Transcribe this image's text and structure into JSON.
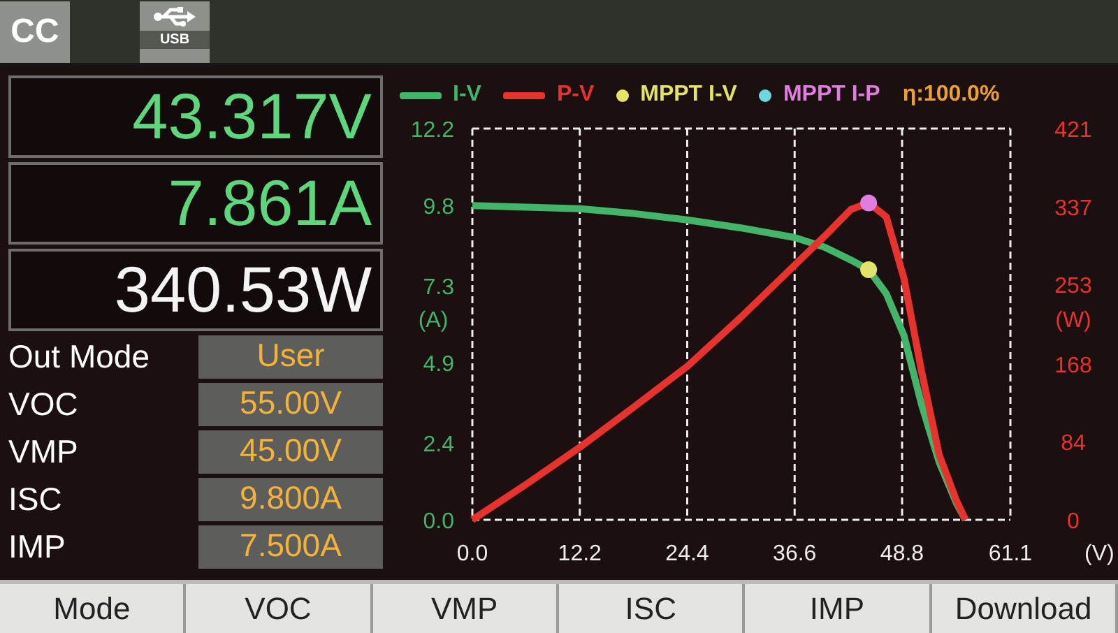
{
  "status_bar": {
    "mode_badge": "CC",
    "usb_label": "USB"
  },
  "readouts": [
    {
      "value": "43.317V",
      "color": "#5ed67c"
    },
    {
      "value": "7.861A",
      "color": "#5ed67c"
    },
    {
      "value": "340.53W",
      "color": "#f4f4f4"
    }
  ],
  "parameters": [
    {
      "label": "Out Mode",
      "value": "User"
    },
    {
      "label": "VOC",
      "value": "55.00V"
    },
    {
      "label": "VMP",
      "value": "45.00V"
    },
    {
      "label": "ISC",
      "value": "9.800A"
    },
    {
      "label": "IMP",
      "value": "7.500A"
    }
  ],
  "chart": {
    "legend": [
      {
        "color": "#43b56a"
      },
      {
        "color": "#e8322e"
      },
      {
        "color": "#e3e36a"
      },
      {
        "color": "#6fd6df"
      }
    ],
    "efficiency": "η:100.0%",
    "current_chart": {
      "chart_data": {
        "type": "line",
        "xlabel": "(V)",
        "ylabel": "(A)",
        "grid": true,
        "x": [
          0,
          6.1,
          12.2,
          18.3,
          24.4,
          30.5,
          36.6,
          40,
          43,
          45,
          47,
          49,
          51,
          53,
          55,
          56
        ],
        "series": [
          {
            "name": "I-V",
            "color": "#43b56a",
            "values": [
              9.8,
              9.75,
              9.7,
              9.55,
              9.35,
              9.1,
              8.8,
              8.5,
              8.1,
              7.8,
              7.05,
              5.75,
              3.6,
              1.8,
              0.5,
              0
            ]
          },
          {
            "name": "MPPT I-V",
            "color": "#e3e36a",
            "marker": true,
            "values": [
              null,
              null,
              null,
              null,
              null,
              null,
              null,
              null,
              null,
              7.8,
              null,
              null,
              null,
              null,
              null,
              null
            ]
          }
        ],
        "xlim": [
          0,
          61.1
        ],
        "ylim": [
          0,
          12.2
        ],
        "xticks": [
          {
            "value": 0,
            "label": "0.0"
          },
          {
            "value": 12.2,
            "label": "12.2"
          },
          {
            "value": 24.4,
            "label": "24.4"
          },
          {
            "value": 36.6,
            "label": "36.6"
          },
          {
            "value": 48.8,
            "label": "48.8"
          },
          {
            "value": 61.1,
            "label": "61.1"
          }
        ],
        "yticks": [
          {
            "value": 0,
            "label": "0.0"
          },
          {
            "value": 2.4,
            "label": "2.4"
          },
          {
            "value": 4.9,
            "label": "4.9"
          },
          {
            "value": 7.3,
            "label": "7.3"
          },
          {
            "value": 9.8,
            "label": "9.8"
          },
          {
            "value": 12.2,
            "label": "12.2"
          }
        ]
      }
    },
    "power_chart": {
      "chart_data": {
        "type": "line",
        "ylabel": "(W)",
        "x": [
          0,
          6.1,
          12.2,
          18.3,
          24.4,
          30.5,
          36.6,
          40,
          43,
          45,
          47,
          49,
          51,
          53,
          55,
          56
        ],
        "series": [
          {
            "name": "P-V",
            "color": "#e8322e",
            "values": [
              0,
              38,
              78,
              121,
              165,
              218,
              274,
              305,
              334,
              341,
              326,
              260,
              160,
              70,
              20,
              0
            ]
          },
          {
            "name": "MPPT I-P",
            "color": "#e07de0",
            "marker": true,
            "values": [
              null,
              null,
              null,
              null,
              null,
              null,
              null,
              null,
              null,
              341,
              null,
              null,
              null,
              null,
              null,
              null
            ]
          }
        ],
        "xlim": [
          0,
          61.1
        ],
        "ylim": [
          0,
          421
        ],
        "yticks": [
          {
            "value": 0,
            "label": "0"
          },
          {
            "value": 84,
            "label": "84"
          },
          {
            "value": 168,
            "label": "168"
          },
          {
            "value": 253,
            "label": "253"
          },
          {
            "value": 337,
            "label": "337"
          },
          {
            "value": 421,
            "label": "421"
          }
        ]
      }
    }
  },
  "softkeys": [
    "Mode",
    "VOC",
    "VMP",
    "ISC",
    "IMP",
    "Download"
  ]
}
